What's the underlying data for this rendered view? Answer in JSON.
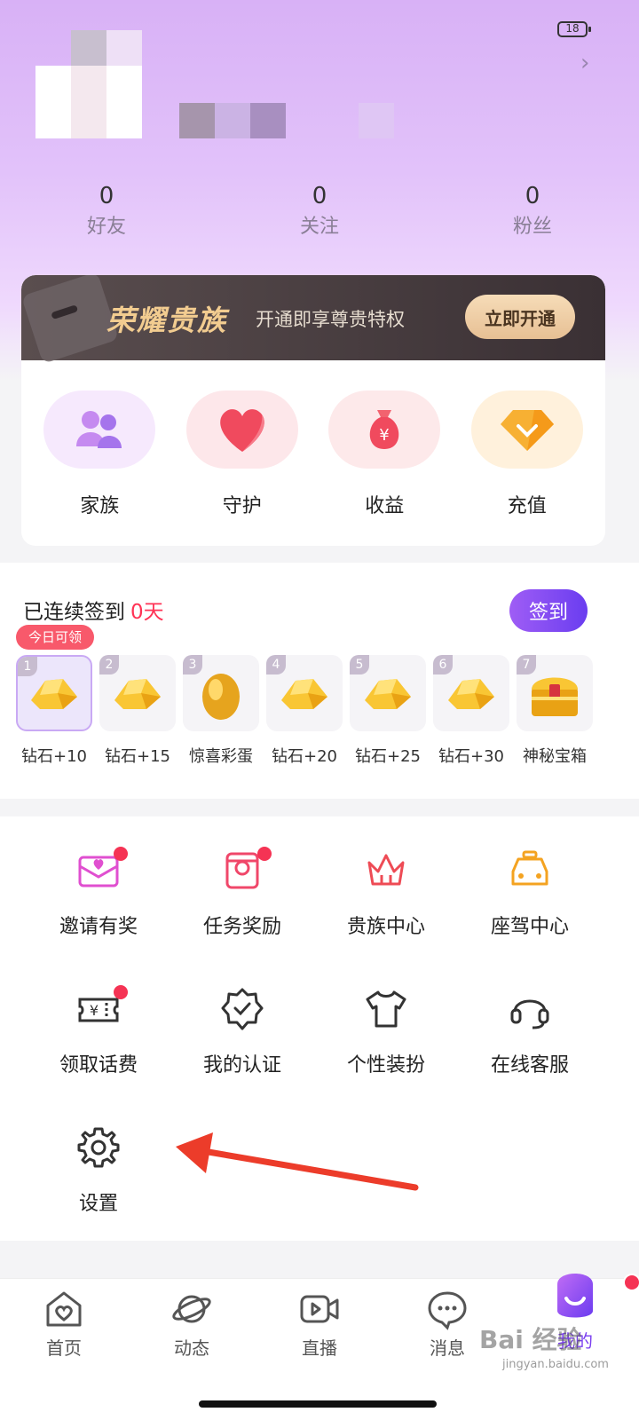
{
  "status_bar": {
    "battery": "18"
  },
  "profile": {
    "stats": [
      {
        "value": "0",
        "label": "好友"
      },
      {
        "value": "0",
        "label": "关注"
      },
      {
        "value": "0",
        "label": "粉丝"
      }
    ]
  },
  "vip": {
    "title": "荣耀贵族",
    "subtitle": "开通即享尊贵特权",
    "button": "立即开通"
  },
  "quick_actions": [
    {
      "label": "家族",
      "icon": "family-icon"
    },
    {
      "label": "守护",
      "icon": "heart-icon"
    },
    {
      "label": "收益",
      "icon": "money-bag-icon"
    },
    {
      "label": "充值",
      "icon": "diamond-icon"
    }
  ],
  "checkin": {
    "title": "已连续签到",
    "days_count": "0天",
    "button": "签到",
    "today_tag": "今日可领",
    "rewards": [
      {
        "day": "1",
        "label": "钻石+10",
        "icon": "gold-ingot-icon"
      },
      {
        "day": "2",
        "label": "钻石+15",
        "icon": "gold-ingot-icon"
      },
      {
        "day": "3",
        "label": "惊喜彩蛋",
        "icon": "golden-egg-icon"
      },
      {
        "day": "4",
        "label": "钻石+20",
        "icon": "gold-ingot-icon"
      },
      {
        "day": "5",
        "label": "钻石+25",
        "icon": "gold-ingot-icon"
      },
      {
        "day": "6",
        "label": "钻石+30",
        "icon": "gold-ingot-icon"
      },
      {
        "day": "7",
        "label": "神秘宝箱",
        "icon": "treasure-chest-icon"
      }
    ]
  },
  "menu": [
    {
      "label": "邀请有奖",
      "icon": "invite-envelope-icon",
      "dot": true
    },
    {
      "label": "任务奖励",
      "icon": "task-reward-icon",
      "dot": true
    },
    {
      "label": "贵族中心",
      "icon": "crown-icon",
      "dot": false
    },
    {
      "label": "座驾中心",
      "icon": "car-icon",
      "dot": false
    },
    {
      "label": "领取话费",
      "icon": "ticket-icon",
      "dot": true
    },
    {
      "label": "我的认证",
      "icon": "verified-badge-icon",
      "dot": false
    },
    {
      "label": "个性装扮",
      "icon": "tshirt-icon",
      "dot": false
    },
    {
      "label": "在线客服",
      "icon": "headset-icon",
      "dot": false
    },
    {
      "label": "设置",
      "icon": "gear-icon",
      "dot": false
    }
  ],
  "tabbar": [
    {
      "label": "首页",
      "icon": "home-icon"
    },
    {
      "label": "动态",
      "icon": "planet-icon"
    },
    {
      "label": "直播",
      "icon": "live-video-icon"
    },
    {
      "label": "消息",
      "icon": "message-icon"
    },
    {
      "label": "我的",
      "icon": "profile-mascot-icon"
    }
  ],
  "watermark": {
    "brand": "Bai 经验",
    "url": "jingyan.baidu.com"
  },
  "colors": {
    "accent": "#7b3ff0",
    "red": "#f53354",
    "vip_gold": "#f2cc90"
  }
}
